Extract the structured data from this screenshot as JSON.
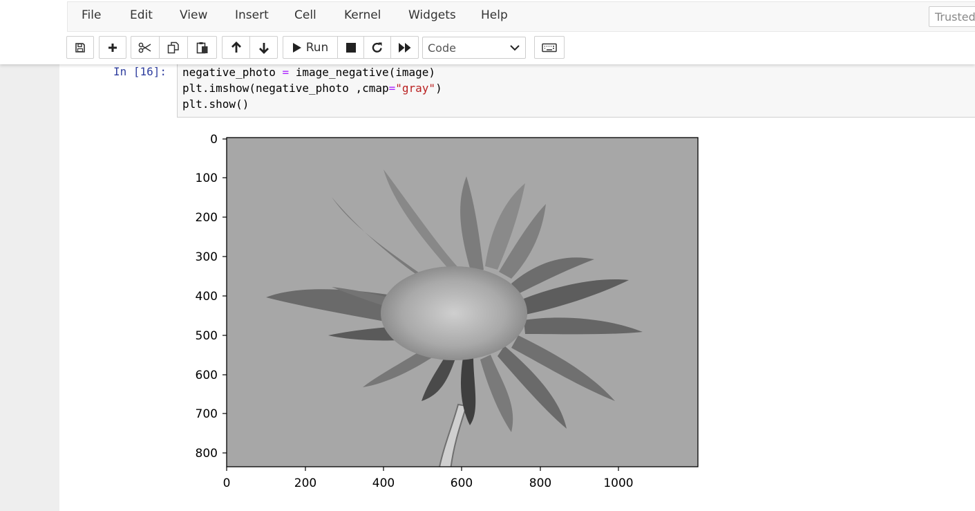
{
  "menu": {
    "items": [
      "File",
      "Edit",
      "View",
      "Insert",
      "Cell",
      "Kernel",
      "Widgets",
      "Help"
    ],
    "trusted": "Trusted"
  },
  "toolbar": {
    "run_label": "Run",
    "cell_type": "Code",
    "icons": [
      "save-icon",
      "plus-icon",
      "cut-icon",
      "copy-icon",
      "paste-icon",
      "arrow-up-icon",
      "arrow-down-icon",
      "play-icon",
      "stop-icon",
      "restart-icon",
      "fast-forward-icon",
      "keyboard-icon"
    ]
  },
  "cell": {
    "prompt": "In [16]:",
    "code": {
      "line1": {
        "a": "negative_photo ",
        "op": "=",
        "b": " image_negative(image)"
      },
      "line2": {
        "a": "plt.imshow(negative_photo ,cmap",
        "op": "=",
        "str": "\"gray\"",
        "b": ")"
      },
      "line3": "plt.show()"
    }
  },
  "output": {
    "xticks": [
      "0",
      "200",
      "400",
      "600",
      "800",
      "1000"
    ],
    "yticks": [
      "0",
      "100",
      "200",
      "300",
      "400",
      "500",
      "600",
      "700",
      "800"
    ]
  }
}
